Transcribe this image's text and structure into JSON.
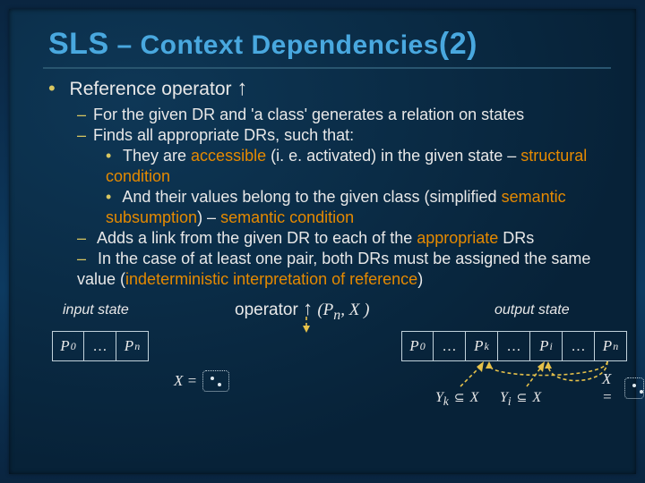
{
  "title": {
    "abbr": "SLS",
    "sep": " – ",
    "rest": "Context Dependencies",
    "num": "(2)"
  },
  "bullets": {
    "b1": {
      "text": "Reference operator ",
      "arrow": "↑"
    },
    "b2_1": "For the given DR and 'a class' generates a relation on states",
    "b2_2": "Finds all appropriate DRs, such that:",
    "b3_1_pre": "They are ",
    "b3_1_em": "accessible",
    "b3_1_post": " (i. e. activated) in the given  state – ",
    "b3_1_em2": "structural condition",
    "b3_2_pre": "And their values belong to the given class (simplified ",
    "b3_2_em": "semantic subsumption",
    "b3_2_mid": ") – ",
    "b3_2_em2": "semantic condition",
    "b2_3_pre": "Adds a link from the given DR to each of the ",
    "b2_3_em": "appropriate ",
    "b2_3_post": "DRs",
    "b2_4_pre": "In the case of at least one pair, both DRs must be assigned the same value (",
    "b2_4_em": "indeterministic interpretation of reference",
    "b2_4_post": ")"
  },
  "diagram": {
    "input_label": "input state",
    "output_label": "output state",
    "operator_word": "operator",
    "operator_arrow": "↑",
    "operator_args_open": "(",
    "operator_arg1": "P",
    "operator_arg1_sub": "n",
    "operator_args_sep": ", ",
    "operator_arg2": "X",
    "operator_args_close": " )",
    "left_cells": [
      {
        "p": "P",
        "sub": "0"
      },
      {
        "dots": "…"
      },
      {
        "p": "P",
        "sub": "n"
      }
    ],
    "right_cells": [
      {
        "p": "P",
        "sub": "0"
      },
      {
        "dots": "…"
      },
      {
        "p": "P",
        "sub": "k"
      },
      {
        "dots": "…"
      },
      {
        "p": "P",
        "sub": "i"
      },
      {
        "dots": "…"
      },
      {
        "p": "P",
        "sub": "n"
      }
    ],
    "xeq": "X =",
    "membership1": {
      "lhs": "Y",
      "lhs_sub": "k",
      "op": "⊆",
      "rhs": "X"
    },
    "membership2": {
      "lhs": "Y",
      "lhs_sub": "i",
      "op": "⊆",
      "rhs": "X"
    }
  },
  "colors": {
    "accent_blue": "#49a8df",
    "highlight_orange": "#e68a00",
    "bullet_gold": "#d9c761"
  }
}
